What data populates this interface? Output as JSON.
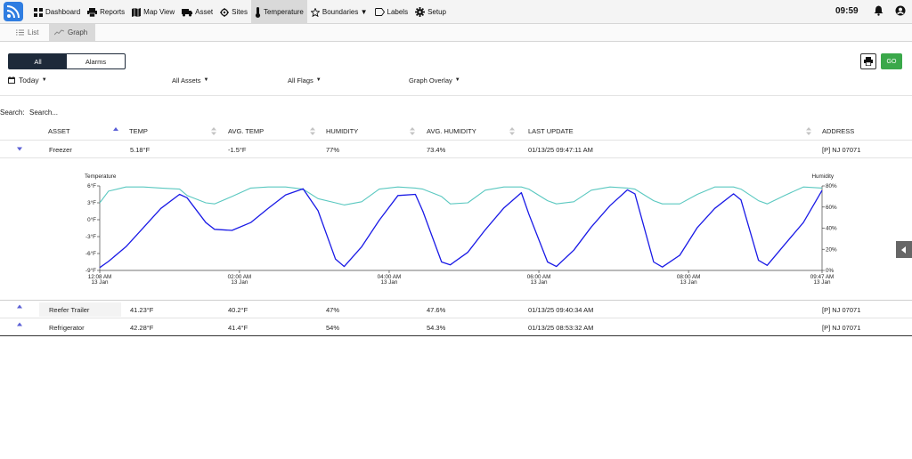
{
  "nav": {
    "items": [
      {
        "label": "Dashboard",
        "icon": "dashboard-icon"
      },
      {
        "label": "Reports",
        "icon": "printer-icon"
      },
      {
        "label": "Map View",
        "icon": "map-icon"
      },
      {
        "label": "Asset",
        "icon": "truck-icon"
      },
      {
        "label": "Sites",
        "icon": "crosshair-icon"
      },
      {
        "label": "Temperature",
        "icon": "thermometer-icon",
        "active": true
      },
      {
        "label": "Boundaries ▼",
        "icon": "star-icon"
      },
      {
        "label": "Labels",
        "icon": "tag-icon"
      },
      {
        "label": "Setup",
        "icon": "gear-icon"
      }
    ],
    "clock": "09:59"
  },
  "subtabs": {
    "list": "List",
    "graph": "Graph"
  },
  "segment": {
    "all": "All",
    "alarms": "Alarms"
  },
  "buttons": {
    "go": "GO"
  },
  "filters": {
    "date": "Today",
    "assets": "All Assets",
    "flags": "All Flags",
    "overlay": "Graph Overlay"
  },
  "search": {
    "label": "Search:",
    "placeholder": "Search..."
  },
  "table": {
    "headers": [
      "ASSET",
      "TEMP",
      "AVG. TEMP",
      "HUMIDITY",
      "AVG. HUMIDITY",
      "LAST UPDATE",
      "ADDRESS"
    ],
    "rows": [
      {
        "asset": "Freezer",
        "temp": "5.18°F",
        "avg_temp": "-1.5°F",
        "humidity": "77%",
        "avg_humidity": "73.4%",
        "last_update": "01/13/25 09:47:11 AM",
        "address": "[P] NJ 07071"
      },
      {
        "asset": "Reefer Trailer",
        "temp": "41.23°F",
        "avg_temp": "40.2°F",
        "humidity": "47%",
        "avg_humidity": "47.6%",
        "last_update": "01/13/25 09:40:34 AM",
        "address": "[P] NJ 07071"
      },
      {
        "asset": "Refrigerator",
        "temp": "42.28°F",
        "avg_temp": "41.4°F",
        "humidity": "54%",
        "avg_humidity": "54.3%",
        "last_update": "01/13/25 08:53:32 AM",
        "address": "[P] NJ 07071"
      }
    ]
  },
  "colors": {
    "temperature_line": "#1a1ae6",
    "humidity_line": "#5ac8c0",
    "go_button": "#3aa84a",
    "segment_active": "#1e2a3a",
    "logo": "#2f7de1"
  },
  "chart_data": {
    "type": "line",
    "ylabel_left": "Temperature",
    "ylabel_right": "Humidity",
    "y_left_ticks": [
      "6°F",
      "3°F",
      "0°F",
      "-3°F",
      "-6°F",
      "-9°F"
    ],
    "y_left_range": [
      -9,
      6
    ],
    "y_right_ticks": [
      "80%",
      "60%",
      "40%",
      "20%",
      "0%"
    ],
    "y_right_range": [
      0,
      80
    ],
    "x_ticks": [
      {
        "time": "12:08 AM",
        "date": "13 Jan"
      },
      {
        "time": "02:00 AM",
        "date": "13 Jan"
      },
      {
        "time": "04:00 AM",
        "date": "13 Jan"
      },
      {
        "time": "06:00 AM",
        "date": "13 Jan"
      },
      {
        "time": "08:00 AM",
        "date": "13 Jan"
      },
      {
        "time": "09:47 AM",
        "date": "13 Jan"
      }
    ],
    "x_range": [
      "12:08 AM",
      "09:47 AM"
    ],
    "series": [
      {
        "axis": "left",
        "x": [
          "12:08 AM",
          "12:15 AM",
          "12:29 AM",
          "12:43 AM",
          "12:57 AM",
          "01:12 AM",
          "01:18 AM",
          "01:33 AM",
          "01:40 AM",
          "01:54 AM",
          "02:09 AM",
          "02:23 AM",
          "02:37 AM",
          "02:51 AM",
          "03:03 AM",
          "03:17 AM",
          "03:24 AM",
          "03:38 AM",
          "03:52 AM",
          "04:07 AM",
          "04:21 AM",
          "04:27 AM",
          "04:42 AM",
          "04:49 AM",
          "05:03 AM",
          "05:17 AM",
          "05:32 AM",
          "05:46 AM",
          "05:52 AM",
          "06:07 AM",
          "06:14 AM",
          "06:28 AM",
          "06:42 AM",
          "06:57 AM",
          "07:11 AM",
          "07:17 AM",
          "07:32 AM",
          "07:39 AM",
          "07:53 AM",
          "08:07 AM",
          "08:21 AM",
          "08:36 AM",
          "08:42 AM",
          "08:56 AM",
          "09:03 AM",
          "09:17 AM",
          "09:32 AM",
          "09:47 AM"
        ],
        "values": [
          -8.5,
          -7.4,
          -4.8,
          -1.4,
          2.0,
          4.5,
          3.9,
          -0.5,
          -1.7,
          -1.9,
          -0.5,
          2.0,
          4.4,
          5.5,
          1.6,
          -7.0,
          -8.3,
          -4.8,
          -0.1,
          4.3,
          4.5,
          1.5,
          -7.5,
          -8.0,
          -5.8,
          -1.8,
          2.1,
          4.8,
          1.0,
          -7.5,
          -8.3,
          -5.4,
          -1.3,
          2.5,
          5.3,
          4.6,
          -7.5,
          -8.4,
          -6.3,
          -1.4,
          2.0,
          4.6,
          3.5,
          -7.2,
          -8.1,
          -4.4,
          -0.5,
          5.2
        ]
      },
      {
        "axis": "right",
        "x": [
          "12:08 AM",
          "12:15 AM",
          "12:29 AM",
          "12:43 AM",
          "12:57 AM",
          "01:12 AM",
          "01:18 AM",
          "01:33 AM",
          "01:40 AM",
          "01:54 AM",
          "02:09 AM",
          "02:23 AM",
          "02:37 AM",
          "02:51 AM",
          "03:03 AM",
          "03:17 AM",
          "03:24 AM",
          "03:38 AM",
          "03:52 AM",
          "04:07 AM",
          "04:21 AM",
          "04:27 AM",
          "04:42 AM",
          "04:49 AM",
          "05:03 AM",
          "05:17 AM",
          "05:32 AM",
          "05:46 AM",
          "05:52 AM",
          "06:07 AM",
          "06:14 AM",
          "06:28 AM",
          "06:42 AM",
          "06:57 AM",
          "07:11 AM",
          "07:17 AM",
          "07:32 AM",
          "07:39 AM",
          "07:53 AM",
          "08:07 AM",
          "08:21 AM",
          "08:36 AM",
          "08:42 AM",
          "08:56 AM",
          "09:03 AM",
          "09:17 AM",
          "09:32 AM",
          "09:47 AM"
        ],
        "values": [
          64,
          75,
          79,
          79,
          78,
          77,
          71,
          64,
          63,
          70,
          78,
          79,
          79,
          77,
          68,
          64,
          62,
          65,
          77,
          79,
          78,
          77,
          70,
          63,
          64,
          76,
          79,
          79,
          77,
          66,
          63,
          65,
          76,
          79,
          78,
          77,
          66,
          63,
          63,
          72,
          79,
          79,
          77,
          66,
          63,
          71,
          79,
          78
        ]
      }
    ],
    "grid": false,
    "legend": "none"
  }
}
